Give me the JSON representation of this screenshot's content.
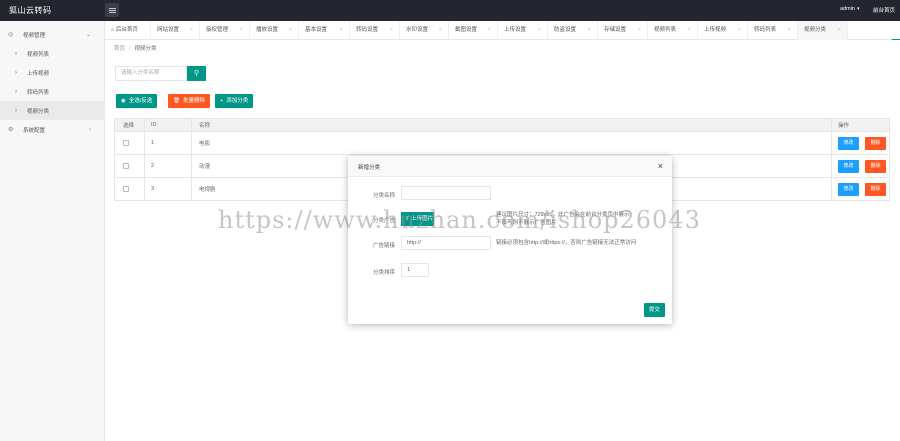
{
  "header": {
    "logo": "狐山云转码",
    "user": "admin",
    "home_link": "前台首页"
  },
  "sidebar": {
    "items": [
      {
        "label": "视频管理",
        "icon": "settings-icon",
        "arrow": "⌄"
      },
      {
        "label": "视频列表"
      },
      {
        "label": "上传视频"
      },
      {
        "label": "转码列表"
      },
      {
        "label": "视频分类"
      },
      {
        "label": "系统配置",
        "icon": "gear-icon",
        "arrow": "‹"
      }
    ]
  },
  "tabs": [
    {
      "label": "后台首页",
      "icon": "home-icon"
    },
    {
      "label": "网站设置"
    },
    {
      "label": "接权管理"
    },
    {
      "label": "播放设置"
    },
    {
      "label": "基本设置"
    },
    {
      "label": "转码设置"
    },
    {
      "label": "水印设置"
    },
    {
      "label": "截图设置"
    },
    {
      "label": "上传设置"
    },
    {
      "label": "防盗设置"
    },
    {
      "label": "存储设置"
    },
    {
      "label": "视频列表"
    },
    {
      "label": "上传视频"
    },
    {
      "label": "转码列表"
    },
    {
      "label": "视频分类"
    }
  ],
  "breadcrumb": {
    "home": "首页",
    "current": "视频分类"
  },
  "search": {
    "placeholder": "请输入分类名称"
  },
  "toolbar": {
    "select_all": "全选/反选",
    "batch_delete": "批量删除",
    "add_category": "添加分类"
  },
  "table": {
    "headers": [
      "选择",
      "ID",
      "名称",
      "操作"
    ],
    "rows": [
      {
        "id": "1",
        "name": "电影"
      },
      {
        "id": "2",
        "name": "动漫"
      },
      {
        "id": "3",
        "name": "电视剧"
      }
    ],
    "edit_label": "修改",
    "delete_label": "删除"
  },
  "modal": {
    "title": "新增分类",
    "name_label": "分类名称",
    "ad_label": "分类广告",
    "upload_label": "上传图片",
    "ad_hint_1": "建议图片尺寸：728x90，此广告会在前台分类页中展示",
    "ad_hint_2": "不填写则不展示广告图片",
    "link_label": "广告链接",
    "link_placeholder": "http://",
    "link_hint": "链接必须包含http://或https://，否则广告链接无法正常访问",
    "sort_label": "分类排序",
    "sort_value": "1",
    "submit": "提交"
  },
  "watermark": "https://www.huzhan.com/ishop26043",
  "colors": {
    "green": "#009688",
    "orange": "#ff5722",
    "blue": "#1e9fff",
    "header": "#23262e"
  }
}
